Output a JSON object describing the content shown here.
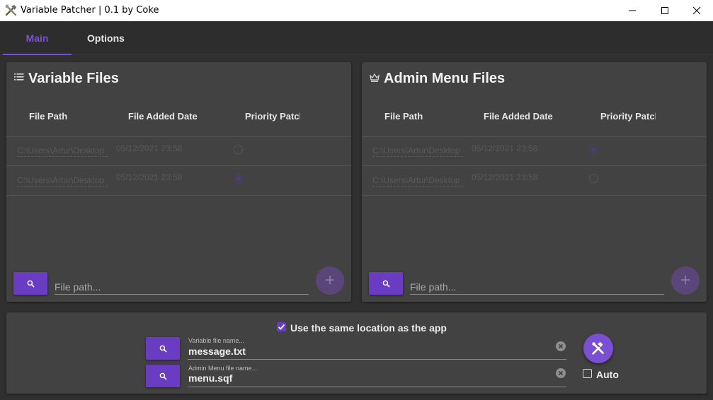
{
  "window": {
    "title": "Variable Patcher | 0.1 by Coke",
    "icon": "tools-icon"
  },
  "tabs": [
    {
      "label": "Main",
      "active": true
    },
    {
      "label": "Options",
      "active": false
    }
  ],
  "colors": {
    "accent": "#7a4fd1",
    "button": "#6a3cc2",
    "background": "#303030",
    "card": "#424242"
  },
  "variable_files": {
    "title": "Variable Files",
    "icon": "list-icon",
    "columns": [
      "File Path",
      "File Added Date",
      "Priority Patch"
    ],
    "rows": [
      {
        "path": "C:\\Users\\Artur\\Desktop",
        "date": "05/12/2021 23:58",
        "priority": false
      },
      {
        "path": "C:\\Users\\Artur\\Desktop",
        "date": "05/12/2021 23:58",
        "priority": true
      }
    ],
    "input_placeholder": "File path..."
  },
  "admin_menu_files": {
    "title": "Admin Menu Files",
    "icon": "crown-icon",
    "columns": [
      "File Path",
      "File Added Date",
      "Priority Patch"
    ],
    "rows": [
      {
        "path": "C:\\Users\\Artur\\Desktop",
        "date": "05/12/2021 23:58",
        "priority": true
      },
      {
        "path": "C:\\Users\\Artur\\Desktop",
        "date": "05/12/2021 23:58",
        "priority": false
      }
    ],
    "input_placeholder": "File path..."
  },
  "bottom": {
    "same_location": {
      "label": "Use the same location as the app",
      "checked": true
    },
    "variable_field": {
      "label": "Variable file name...",
      "value": "message.txt"
    },
    "admin_field": {
      "label": "Admin Menu file name...",
      "value": "menu.sqf"
    },
    "auto": {
      "label": "Auto",
      "checked": false
    }
  }
}
